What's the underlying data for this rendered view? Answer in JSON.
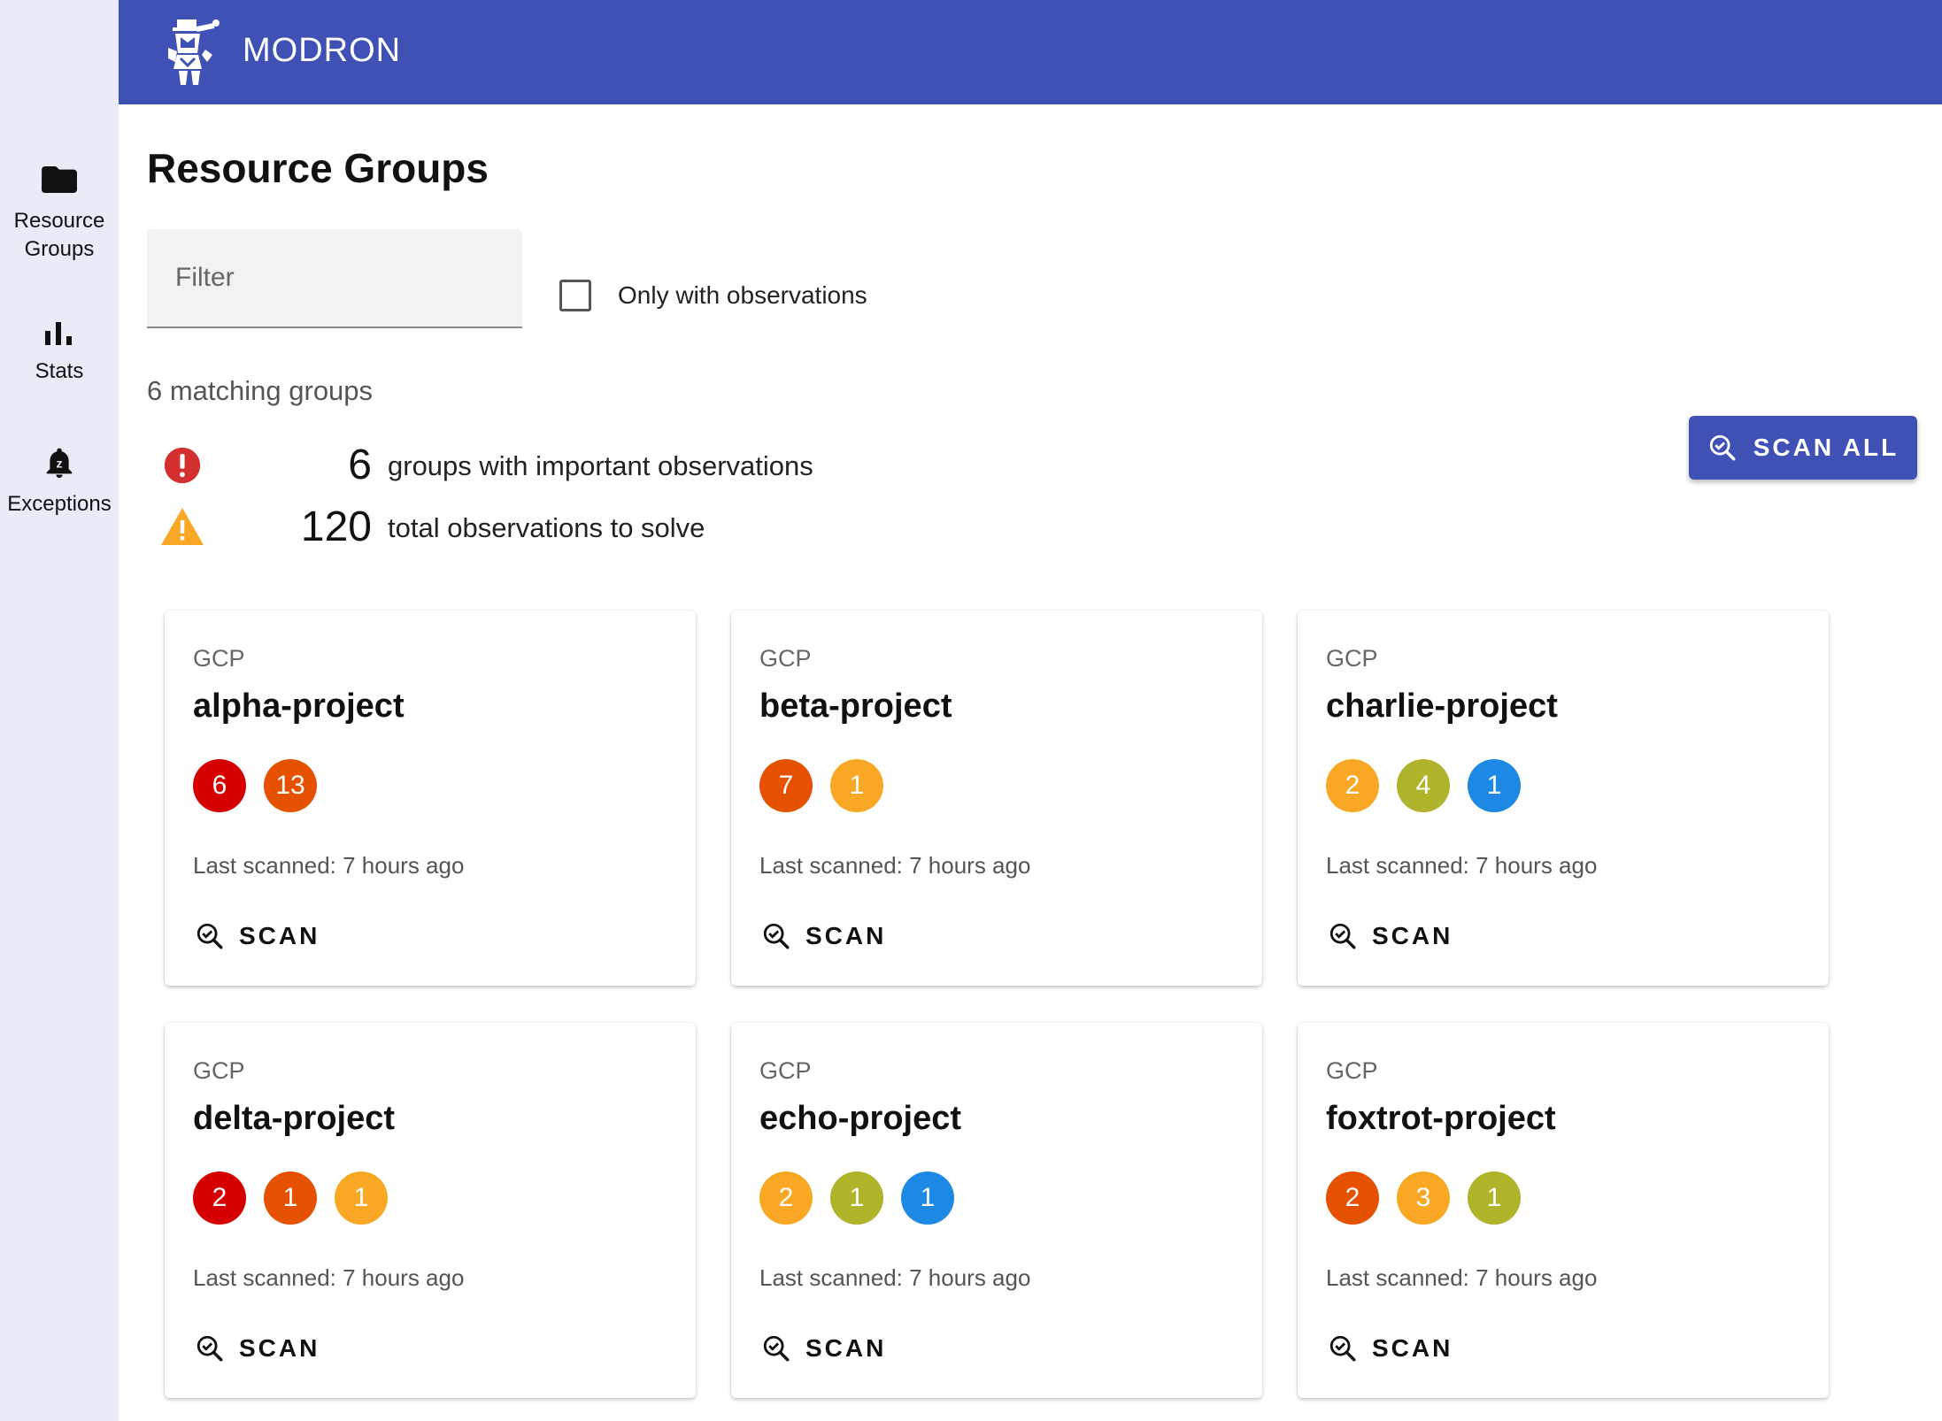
{
  "app": {
    "title": "MODRON"
  },
  "sidebar": {
    "items": [
      {
        "label": "Resource\nGroups",
        "icon": "folder-icon"
      },
      {
        "label": "Stats",
        "icon": "bar-chart-icon"
      },
      {
        "label": "Exceptions",
        "icon": "notification-bell-icon"
      }
    ]
  },
  "page": {
    "title": "Resource Groups",
    "filter_placeholder": "Filter",
    "only_observations_label": "Only with observations",
    "matching_text": "6 matching groups"
  },
  "summary": {
    "important_count": "6",
    "important_text": "groups with important observations",
    "total_count": "120",
    "total_text": "total observations to solve"
  },
  "scan_all_label": "SCAN ALL",
  "colors": {
    "primary": "#3f51b5",
    "critical": "#d50000",
    "high": "#e65100",
    "medium": "#f9a825",
    "low": "#afb42b",
    "info": "#1e88e5",
    "error_icon": "#d32f2f",
    "warning_icon": "#f9a825"
  },
  "cards": [
    {
      "provider": "GCP",
      "name": "alpha-project",
      "last_scanned": "Last scanned: 7 hours ago",
      "scan_label": "SCAN",
      "badges": [
        {
          "value": "6",
          "color": "#d50000"
        },
        {
          "value": "13",
          "color": "#e65100"
        }
      ]
    },
    {
      "provider": "GCP",
      "name": "beta-project",
      "last_scanned": "Last scanned: 7 hours ago",
      "scan_label": "SCAN",
      "badges": [
        {
          "value": "7",
          "color": "#e65100"
        },
        {
          "value": "1",
          "color": "#f9a825"
        }
      ]
    },
    {
      "provider": "GCP",
      "name": "charlie-project",
      "last_scanned": "Last scanned: 7 hours ago",
      "scan_label": "SCAN",
      "badges": [
        {
          "value": "2",
          "color": "#f9a825"
        },
        {
          "value": "4",
          "color": "#afb42b"
        },
        {
          "value": "1",
          "color": "#1e88e5"
        }
      ]
    },
    {
      "provider": "GCP",
      "name": "delta-project",
      "last_scanned": "Last scanned: 7 hours ago",
      "scan_label": "SCAN",
      "badges": [
        {
          "value": "2",
          "color": "#d50000"
        },
        {
          "value": "1",
          "color": "#e65100"
        },
        {
          "value": "1",
          "color": "#f9a825"
        }
      ]
    },
    {
      "provider": "GCP",
      "name": "echo-project",
      "last_scanned": "Last scanned: 7 hours ago",
      "scan_label": "SCAN",
      "badges": [
        {
          "value": "2",
          "color": "#f9a825"
        },
        {
          "value": "1",
          "color": "#afb42b"
        },
        {
          "value": "1",
          "color": "#1e88e5"
        }
      ]
    },
    {
      "provider": "GCP",
      "name": "foxtrot-project",
      "last_scanned": "Last scanned: 7 hours ago",
      "scan_label": "SCAN",
      "badges": [
        {
          "value": "2",
          "color": "#e65100"
        },
        {
          "value": "3",
          "color": "#f9a825"
        },
        {
          "value": "1",
          "color": "#afb42b"
        }
      ]
    }
  ]
}
